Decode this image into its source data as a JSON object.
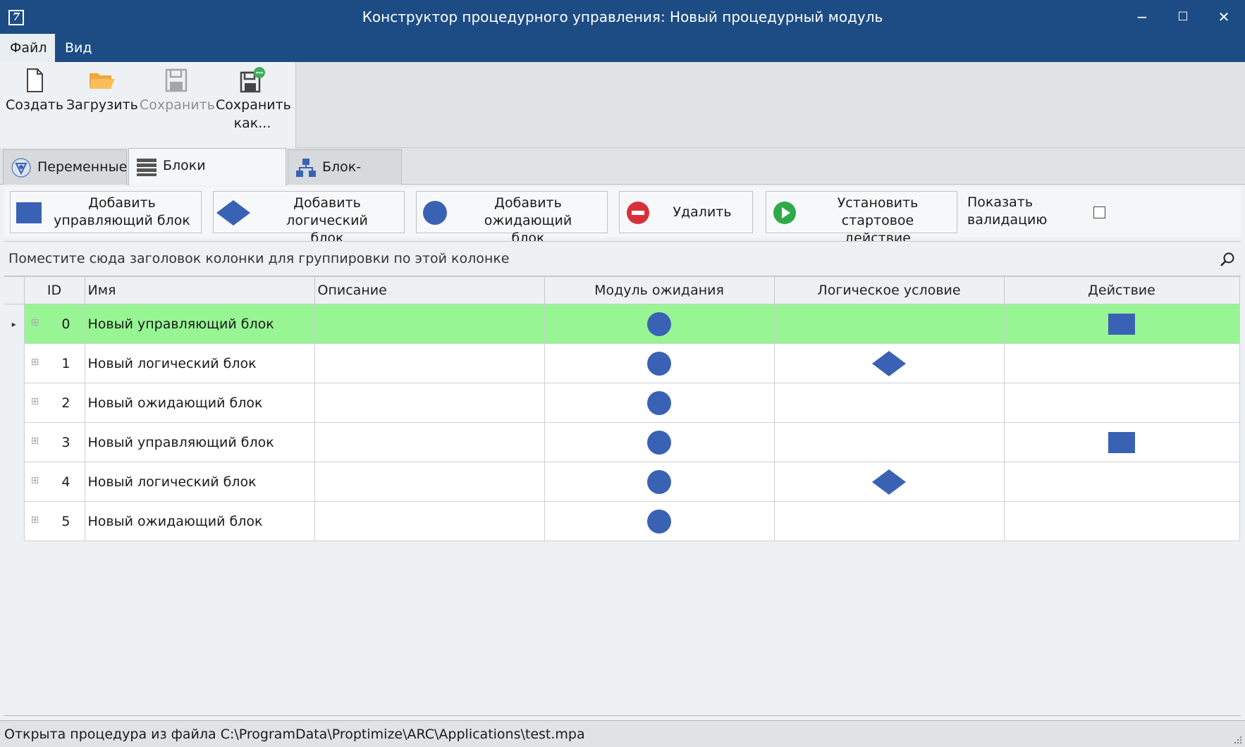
{
  "window": {
    "title": "Конструктор процедурного управления: Новый процедурный модуль",
    "minimize": "−",
    "maximize": "☐",
    "close": "✕",
    "app_icon": "7"
  },
  "menu": {
    "file": "Файл",
    "view": "Вид"
  },
  "toolbar": {
    "create": "Создать",
    "load": "Загрузить",
    "save": "Сохранить",
    "save_as_line1": "Сохранить",
    "save_as_line2": "как..."
  },
  "tabs": {
    "variables": "Переменные",
    "blocks": "Блоки процедуры",
    "flowchart": "Блок-схема"
  },
  "actions": {
    "add_control_l1": "Добавить",
    "add_control_l2": "управляющий блок",
    "add_logic_l1": "Добавить логический",
    "add_logic_l2": "блок",
    "add_wait_l1": "Добавить ожидающий",
    "add_wait_l2": "блок",
    "delete": "Удалить",
    "set_start_l1": "Установить стартовое",
    "set_start_l2": "действие",
    "show_validation_l1": "Показать",
    "show_validation_l2": "валидацию"
  },
  "grid": {
    "group_hint": "Поместите сюда заголовок колонки для группировки по этой колонке",
    "columns": {
      "id": "ID",
      "name": "Имя",
      "description": "Описание",
      "wait": "Модуль ожидания",
      "logic": "Логическое условие",
      "action": "Действие"
    },
    "rows": [
      {
        "id": "0",
        "name": "Новый управляющий блок",
        "description": ""
      },
      {
        "id": "1",
        "name": "Новый логический блок",
        "description": ""
      },
      {
        "id": "2",
        "name": "Новый ожидающий блок",
        "description": ""
      },
      {
        "id": "3",
        "name": "Новый управляющий блок",
        "description": ""
      },
      {
        "id": "4",
        "name": "Новый логический блок",
        "description": ""
      },
      {
        "id": "5",
        "name": "Новый ожидающий блок",
        "description": ""
      }
    ]
  },
  "status": {
    "message": "Открыта процедура из файла C:\\ProgramData\\Proptimize\\ARC\\Applications\\test.mpa"
  },
  "colors": {
    "titlebar": "#1d4c84",
    "shape": "#3a62b4",
    "selected_row": "#97f593"
  }
}
